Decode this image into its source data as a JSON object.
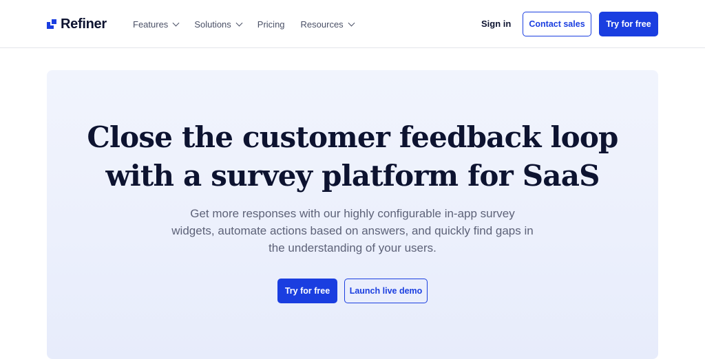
{
  "header": {
    "logo_text": "Refiner",
    "nav": [
      {
        "label": "Features",
        "has_dropdown": true
      },
      {
        "label": "Solutions",
        "has_dropdown": true
      },
      {
        "label": "Pricing",
        "has_dropdown": false
      },
      {
        "label": "Resources",
        "has_dropdown": true
      }
    ],
    "sign_in": "Sign in",
    "contact_sales": "Contact sales",
    "try_free": "Try for free"
  },
  "hero": {
    "title_line1": "Close the customer feedback loop",
    "title_line2": "with a survey platform for SaaS",
    "subtitle_line1": "Get more responses with our highly configurable in-app survey",
    "subtitle_line2": "widgets, automate actions based on answers, and quickly find gaps in",
    "subtitle_line3": "the understanding of your users.",
    "primary_cta": "Try for free",
    "secondary_cta": "Launch live demo"
  },
  "colors": {
    "brand_blue": "#1a3ee0",
    "heading": "#0d1330",
    "body_text": "#5d6278",
    "hero_bg": "#eef1fc"
  },
  "icons": {
    "logo": "refiner-logo-mark",
    "dropdown": "chevron-down-icon"
  }
}
